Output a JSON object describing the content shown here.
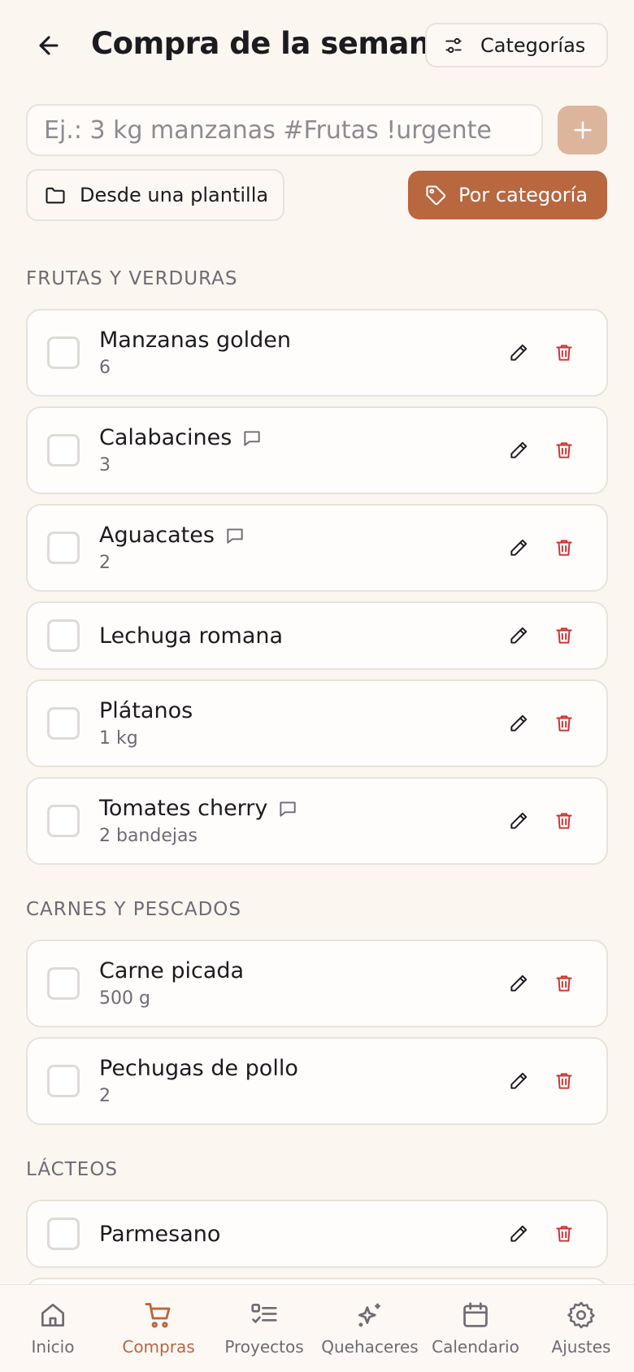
{
  "header": {
    "title": "Compra de la semana",
    "categories_label": "Categorías"
  },
  "add_bar": {
    "placeholder": "Ej.: 3 kg manzanas #Frutas !urgente",
    "template_label": "Desde una plantilla",
    "by_category_label": "Por categoría"
  },
  "colors": {
    "accent": "#b9673f",
    "accent_light": "#ddb59d",
    "delete": "#d32f2f",
    "background": "#fcf6f1"
  },
  "sections": [
    {
      "title": "FRUTAS Y VERDURAS",
      "items": [
        {
          "name": "Manzanas golden",
          "qty": "6",
          "has_note": false
        },
        {
          "name": "Calabacines",
          "qty": "3",
          "has_note": true
        },
        {
          "name": "Aguacates",
          "qty": "2",
          "has_note": true
        },
        {
          "name": "Lechuga romana",
          "qty": "",
          "has_note": false
        },
        {
          "name": "Plátanos",
          "qty": "1 kg",
          "has_note": false
        },
        {
          "name": "Tomates cherry",
          "qty": "2 bandejas",
          "has_note": true
        }
      ]
    },
    {
      "title": "CARNES Y PESCADOS",
      "items": [
        {
          "name": "Carne picada",
          "qty": "500 g",
          "has_note": false
        },
        {
          "name": "Pechugas de pollo",
          "qty": "2",
          "has_note": false
        }
      ]
    },
    {
      "title": "LÁCTEOS",
      "items": [
        {
          "name": "Parmesano",
          "qty": "",
          "has_note": false
        }
      ]
    }
  ],
  "nav": [
    {
      "label": "Inicio",
      "icon": "home-icon",
      "active": false
    },
    {
      "label": "Compras",
      "icon": "cart-icon",
      "active": true
    },
    {
      "label": "Proyectos",
      "icon": "checklist-icon",
      "active": false
    },
    {
      "label": "Quehaceres",
      "icon": "sparkles-icon",
      "active": false
    },
    {
      "label": "Calendario",
      "icon": "calendar-icon",
      "active": false
    },
    {
      "label": "Ajustes",
      "icon": "gear-icon",
      "active": false
    }
  ]
}
